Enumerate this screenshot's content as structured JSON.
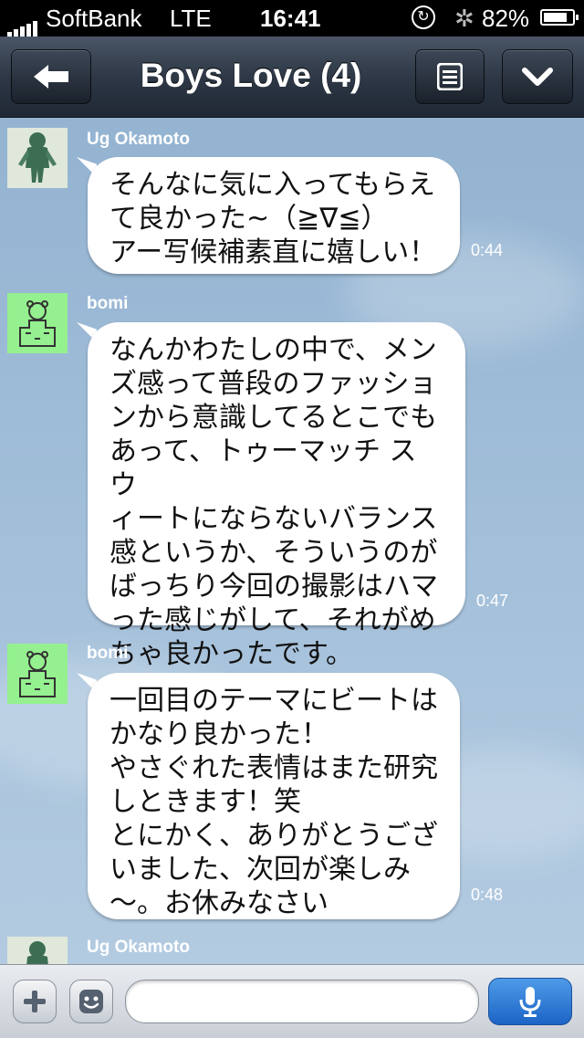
{
  "status_bar": {
    "carrier": "SoftBank",
    "network": "LTE",
    "time": "16:41",
    "battery_percent": "82%",
    "battery_level": 0.82
  },
  "nav": {
    "title": "Boys Love (4)",
    "back_icon": "back-arrow-icon",
    "menu_icon": "menu-list-icon",
    "down_icon": "chevron-down-icon"
  },
  "messages": [
    {
      "sender": "Ug Okamoto",
      "text": "そんなに気に入ってもらえ\nて良かった~（≧∇≦）\nアー写候補素直に嬉しい！",
      "time": "0:44"
    },
    {
      "sender": "bomi",
      "text": "なんかわたしの中で、メン\nズ感って普段のファッショ\nンから意識してるとこでも\nあって、トゥーマッチ スウ\nィートにならないバランス\n感というか、そういうのが\nばっちり今回の撮影はハマ\nった感じがして、それがめ\nちゃ良かったです。",
      "time": "0:47"
    },
    {
      "sender": "bomi",
      "text": "一回目のテーマにビートは\nかなり良かった！\nやさぐれた表情はまた研究\nしときます！笑\nとにかく、ありがとうござ\nいました、次回が楽しみ\n〜。お休みなさい",
      "time": "0:48"
    },
    {
      "sender": "Ug Okamoto"
    }
  ],
  "input_bar": {
    "plus_icon": "plus-icon",
    "emoji_icon": "emoji-icon",
    "mic_icon": "microphone-icon",
    "message_value": ""
  }
}
